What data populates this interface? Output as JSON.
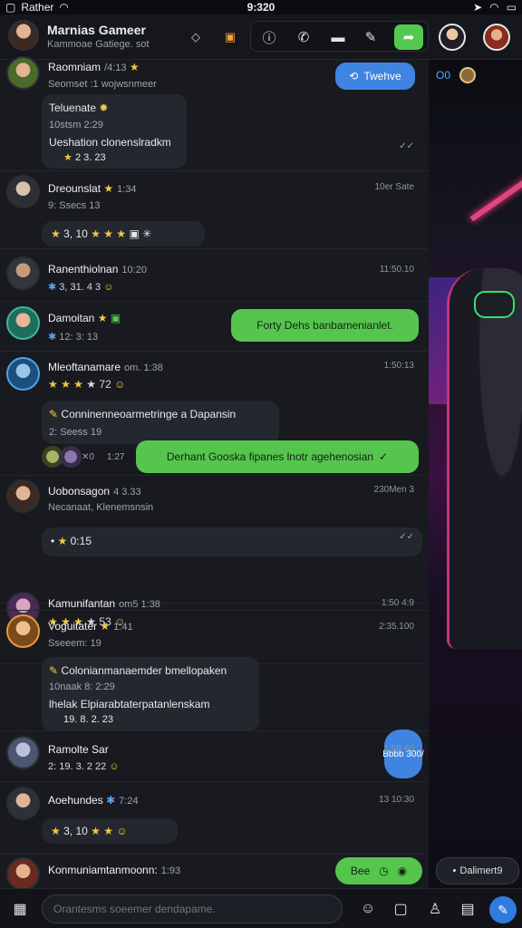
{
  "status_bar": {
    "carrier": "Rather",
    "time": "9:320",
    "battery": "100"
  },
  "header": {
    "title": "Marnias Gameer",
    "subtitle": "Kammoae Gatiege. sot"
  },
  "messages": [
    {
      "name": "Raomniam",
      "time": "/4:13",
      "meta": "Seomset :1 wojwsnmeer",
      "bubble_lines": [
        "Teluenate",
        "10stsm 2:29",
        "Ueshation clonenslradkm",
        "2 3. 23"
      ]
    },
    {
      "name": "Dreounslat",
      "time": "1:34",
      "meta": "9: Ssecs 13",
      "right": "10er Sate",
      "reactions": "3, 10"
    },
    {
      "name": "Ranenthiolnan",
      "time": "10:20",
      "meta": "3, 31. 4 3",
      "right": "11:50.10"
    },
    {
      "name": "Damoitan",
      "meta": "12: 3: 13",
      "green": "Forty Dehs banbamenianlet."
    },
    {
      "name": "Mleoftanamare",
      "time": "om. 1:38",
      "reaction_value": "72",
      "right": "1:50:13",
      "bubble": "Conninenneoarmetringe a Dapansin",
      "sub": "2: Seess 19",
      "green": "Derhant Gooska fipanes lnotr agehenosian",
      "side_time": "1:27"
    },
    {
      "name": "Uobonsagon",
      "time": "4 3.33",
      "meta": "Necanaat, Klenemsnsin",
      "right": "230Men 3",
      "reactions": "0:15"
    },
    {
      "name": "Kamunifantan",
      "time": "om5 1:38",
      "reaction_value": "53",
      "right": "1:50 4:9"
    },
    {
      "name": "Voguitater",
      "time": "1:41",
      "meta": "Sseeem: 19",
      "right": "2:35.100",
      "bubble_lines": [
        "Colonianmanaemder bmellopaken",
        "10naak 8: 2:29",
        "lhelak Elpiarabtaterpatanlenskam",
        "19. 8. 2. 23"
      ],
      "blue": "Bbbb 300/"
    },
    {
      "name": "Ramolte Sar",
      "meta": "2: 19. 3. 2 22",
      "right": "1:50 60"
    },
    {
      "name": "Aoehundes",
      "time": "7:24",
      "right": "13 10:30",
      "reactions": "3, 10"
    },
    {
      "name": "Konmuniamtanmoonn:",
      "time": "1:93",
      "green": "Bee"
    }
  ],
  "blue_top": "Twehve",
  "panel": {
    "top_label": "Ο0",
    "badge": "Dalimert9"
  },
  "composer": {
    "placeholder": "Orantesms soeemer dendapame."
  },
  "colors": {
    "accent_green": "#56c54e",
    "accent_blue": "#3f84e0",
    "background": "#181a20"
  }
}
